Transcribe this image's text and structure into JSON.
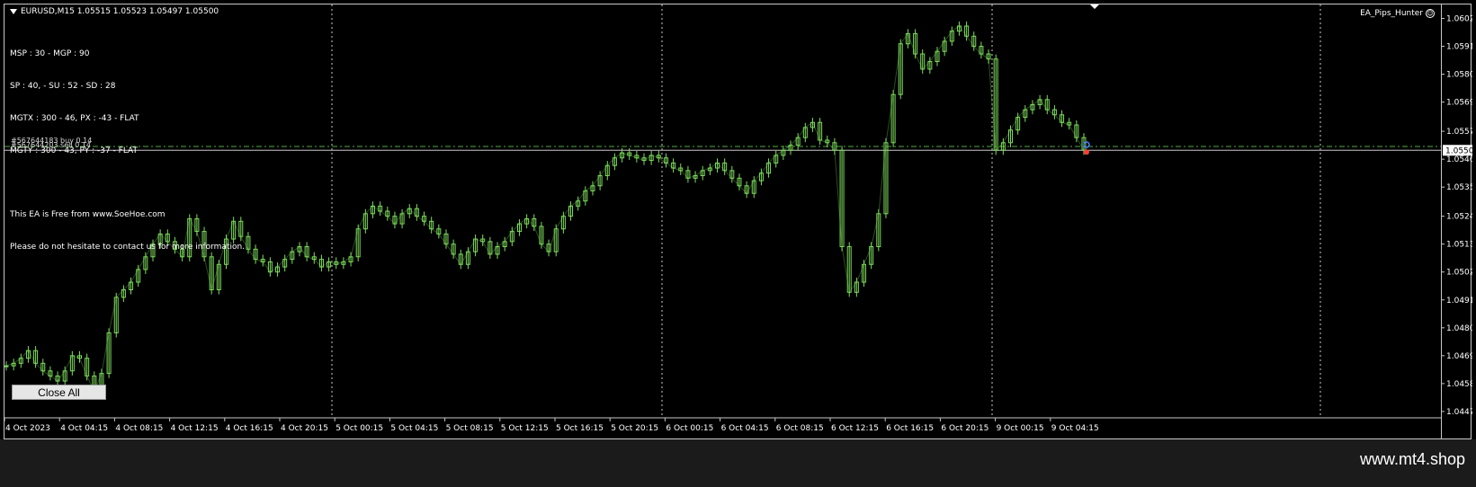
{
  "header": {
    "symbol_info": "EURUSD,M15  1.05515 1.05523 1.05497 1.05500",
    "ea_name": "EA_Pips_Hunter"
  },
  "info_panel": {
    "line1": "MSP : 30 - MGP : 90",
    "line2": "SP : 40, - SU : 52 - SD : 28",
    "line3": "MGTX : 300 - 46, PX : -43 - FLAT",
    "line4": "MGTY : 300 - 43, PY : -37 - FLAT",
    "line5": "This EA is Free from www.SoeHoe.com",
    "line6": "Please do not hesitate to contact us for more information."
  },
  "trades": {
    "buy_label": "#567644183 buy 0.14",
    "sell_label": "#567644203 sell 0.14"
  },
  "close_all_label": "Close All",
  "watermark": "www.mt4.shop",
  "colors": {
    "candle": "#7cdc5a",
    "background": "#000000",
    "grid": "#c8c8c8",
    "trade_line": "#4cae3c"
  },
  "chart_data": {
    "type": "line",
    "symbol": "EURUSD",
    "timeframe": "M15",
    "price_ticks": [
      "1.06020",
      "1.05910",
      "1.05800",
      "1.05690",
      "1.05575",
      "1.05465",
      "1.05355",
      "1.05240",
      "1.05130",
      "1.05020",
      "1.04910",
      "1.04800",
      "1.04690",
      "1.04580",
      "1.04470"
    ],
    "current_price": "1.05500",
    "ylim": [
      1.04445,
      1.06075
    ],
    "time_labels": [
      "4 Oct 2023",
      "4 Oct 04:15",
      "4 Oct 08:15",
      "4 Oct 12:15",
      "4 Oct 16:15",
      "4 Oct 20:15",
      "5 Oct 00:15",
      "5 Oct 04:15",
      "5 Oct 08:15",
      "5 Oct 12:15",
      "5 Oct 16:15",
      "5 Oct 20:15",
      "6 Oct 00:15",
      "6 Oct 04:15",
      "6 Oct 08:15",
      "6 Oct 12:15",
      "6 Oct 16:15",
      "6 Oct 20:15",
      "9 Oct 00:15",
      "9 Oct 04:15"
    ],
    "day_separators": [
      "5 Oct 00:00",
      "6 Oct 00:00",
      "9 Oct 00:00"
    ],
    "trade_levels": {
      "buy": 1.05515,
      "sell": 1.055
    },
    "series": [
      {
        "values": [
          1.0465,
          1.0466,
          1.0468,
          1.0471,
          1.0466,
          1.0463,
          1.0461,
          1.0459,
          1.0463,
          1.0469,
          1.0468,
          1.0461,
          1.0455,
          1.0462,
          1.0478,
          1.0492,
          1.0495,
          1.0498,
          1.0503,
          1.0508,
          1.0513,
          1.0517,
          1.0514,
          1.0511,
          1.0508,
          1.0523,
          1.0518,
          1.0508,
          1.0495,
          1.0505,
          1.0515,
          1.0522,
          1.0516,
          1.0511,
          1.0507,
          1.0506,
          1.0502,
          1.0504,
          1.0507,
          1.051,
          1.0512,
          1.0508,
          1.0507,
          1.0504,
          1.0506,
          1.0505,
          1.0506,
          1.0508,
          1.0519,
          1.0525,
          1.0528,
          1.0526,
          1.0524,
          1.0521,
          1.0525,
          1.0527,
          1.0524,
          1.0522,
          1.0519,
          1.0517,
          1.0513,
          1.0509,
          1.0505,
          1.051,
          1.0515,
          1.0514,
          1.0509,
          1.0512,
          1.0514,
          1.0518,
          1.0521,
          1.0523,
          1.052,
          1.0513,
          1.051,
          1.0519,
          1.0524,
          1.0528,
          1.053,
          1.0534,
          1.0536,
          1.054,
          1.0544,
          1.0547,
          1.0549,
          1.0548,
          1.0547,
          1.0546,
          1.0548,
          1.0547,
          1.0545,
          1.0543,
          1.0542,
          1.0539,
          1.054,
          1.0542,
          1.0543,
          1.0545,
          1.0542,
          1.0539,
          1.0536,
          1.0533,
          1.0538,
          1.0541,
          1.0545,
          1.0548,
          1.055,
          1.0552,
          1.0555,
          1.0559,
          1.0561,
          1.0554,
          1.0553,
          1.055,
          1.0512,
          1.0494,
          1.0498,
          1.0505,
          1.0512,
          1.0525,
          1.0553,
          1.0572,
          1.0592,
          1.0596,
          1.0588,
          1.0582,
          1.0585,
          1.0589,
          1.0593,
          1.0597,
          1.0599,
          1.0595,
          1.0591,
          1.0588,
          1.0586,
          1.055,
          1.0553,
          1.0558,
          1.0563,
          1.0566,
          1.0568,
          1.057,
          1.0566,
          1.0564,
          1.0561,
          1.056,
          1.0555,
          1.055
        ]
      }
    ]
  }
}
